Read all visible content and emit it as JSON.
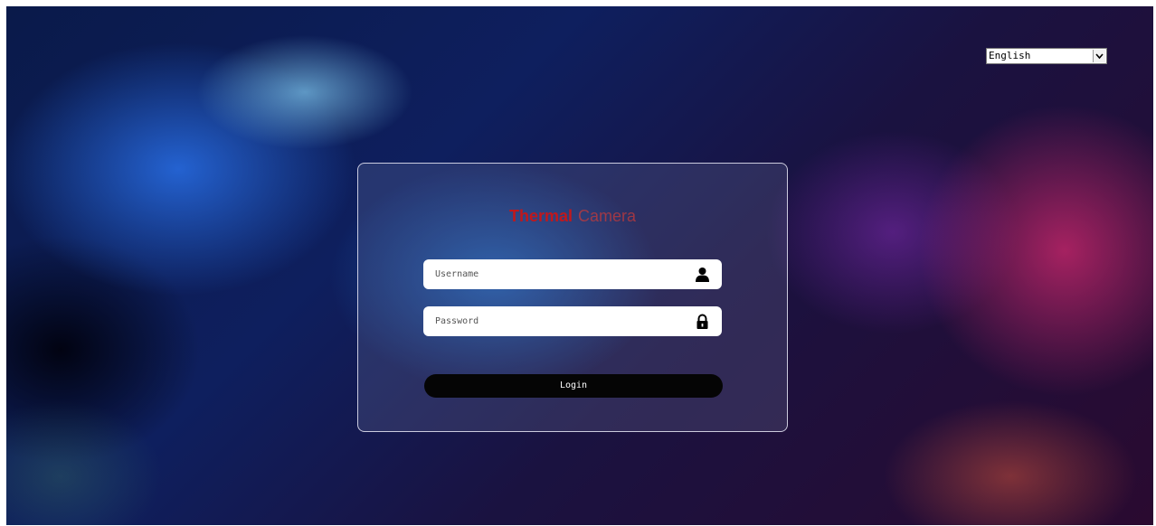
{
  "language": {
    "selected": "English"
  },
  "login_card": {
    "brand_primary": "Thermal",
    "brand_secondary": "Camera",
    "username_placeholder": "Username",
    "password_placeholder": "Password",
    "login_label": "Login"
  },
  "icons": {
    "username": "user-icon",
    "password": "lock-icon",
    "dropdown": "chevron-down-icon"
  },
  "colors": {
    "brand_red": "#c0181c",
    "button_bg": "#050505"
  }
}
